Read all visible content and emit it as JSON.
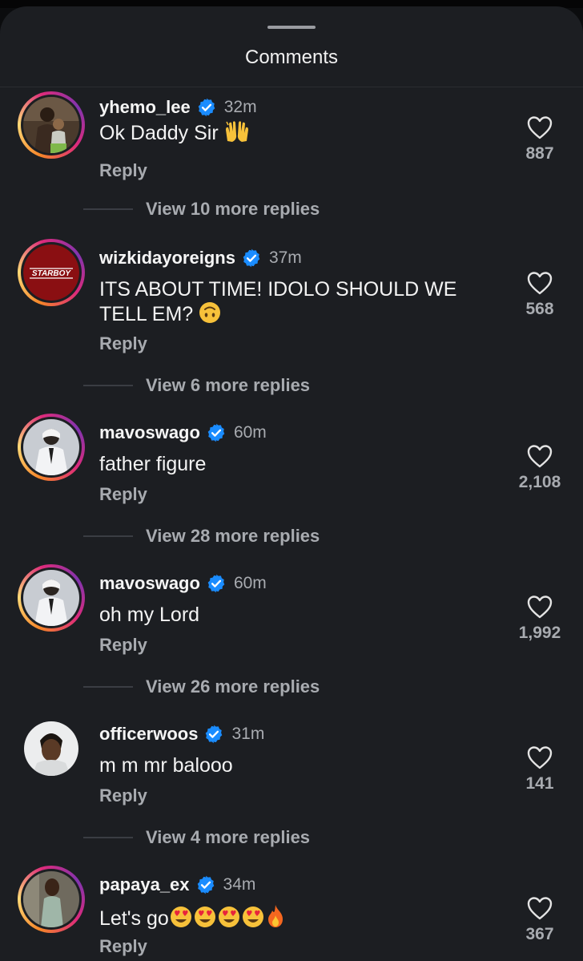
{
  "sheet": {
    "title": "Comments"
  },
  "comments": [
    {
      "username": "yhemo_lee",
      "time": "32m",
      "text": "Ok Daddy Sir",
      "emojis": [
        "raised-hands"
      ],
      "reply": "Reply",
      "likes": "887",
      "view_replies": "View 10 more replies",
      "avatar": "person-holding-child"
    },
    {
      "username": "wizkidayoreigns",
      "time": "37m",
      "text_line1": "ITS ABOUT TIME! IDOLO SHOULD WE",
      "text_line2": "TELL EM?",
      "emojis": [
        "upside-down-face"
      ],
      "reply": "Reply",
      "likes": "568",
      "view_replies": "View 6 more replies",
      "avatar": "starboy-logo",
      "logo_text": "STARBOY"
    },
    {
      "username": "mavoswago",
      "time": "60m",
      "text": "father figure",
      "reply": "Reply",
      "likes": "2,108",
      "view_replies": "View 28 more replies",
      "avatar": "man-white-suit"
    },
    {
      "username": "mavoswago",
      "time": "60m",
      "text": "oh my Lord",
      "reply": "Reply",
      "likes": "1,992",
      "view_replies": "View 26 more replies",
      "avatar": "man-white-suit"
    },
    {
      "username": "officerwoos",
      "time": "31m",
      "text": "m m mr balooo",
      "reply": "Reply",
      "likes": "141",
      "view_replies": "View 4 more replies",
      "avatar": "man-portrait"
    },
    {
      "username": "papaya_ex",
      "time": "34m",
      "text": "Let's go",
      "emojis": [
        "heart-eyes",
        "heart-eyes",
        "heart-eyes",
        "heart-eyes",
        "fire"
      ],
      "reply": "Reply",
      "likes": "367",
      "avatar": "woman-portrait"
    }
  ],
  "colors": {
    "background": "#1c1e22",
    "verified": "#1a8cff",
    "muted_text": "#a8abb0"
  }
}
